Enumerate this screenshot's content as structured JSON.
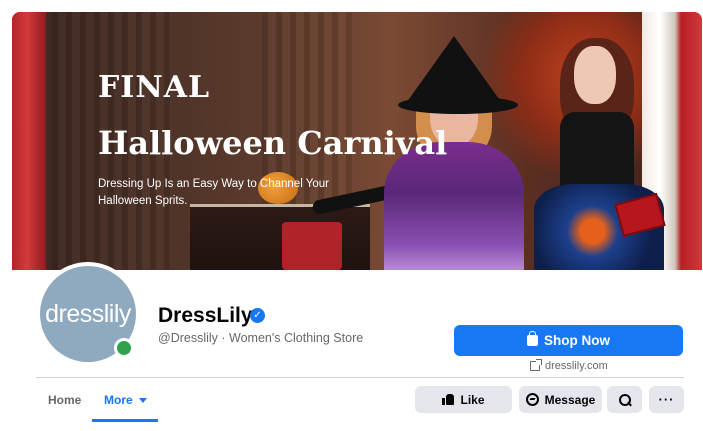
{
  "banner": {
    "title_line1": "FINAL",
    "title_line2": "Halloween Carnival",
    "subtitle": "Dressing Up Is an Easy Way to Channel Your Halloween Sprits."
  },
  "profile": {
    "avatar_text": "dresslily",
    "page_name": "DressLily",
    "verified_glyph": "✓",
    "handle_line": "@Dresslily · Women's Clothing Store"
  },
  "cta": {
    "shop_label": "Shop Now",
    "website": "dresslily.com"
  },
  "tabs": [
    {
      "label": "Home"
    },
    {
      "label": "More"
    }
  ],
  "actions": {
    "like_label": "Like",
    "message_label": "Message",
    "more_glyph": "···"
  },
  "colors": {
    "accent": "#1877f2",
    "online": "#31a24c",
    "button_bg": "#e4e6eb"
  }
}
